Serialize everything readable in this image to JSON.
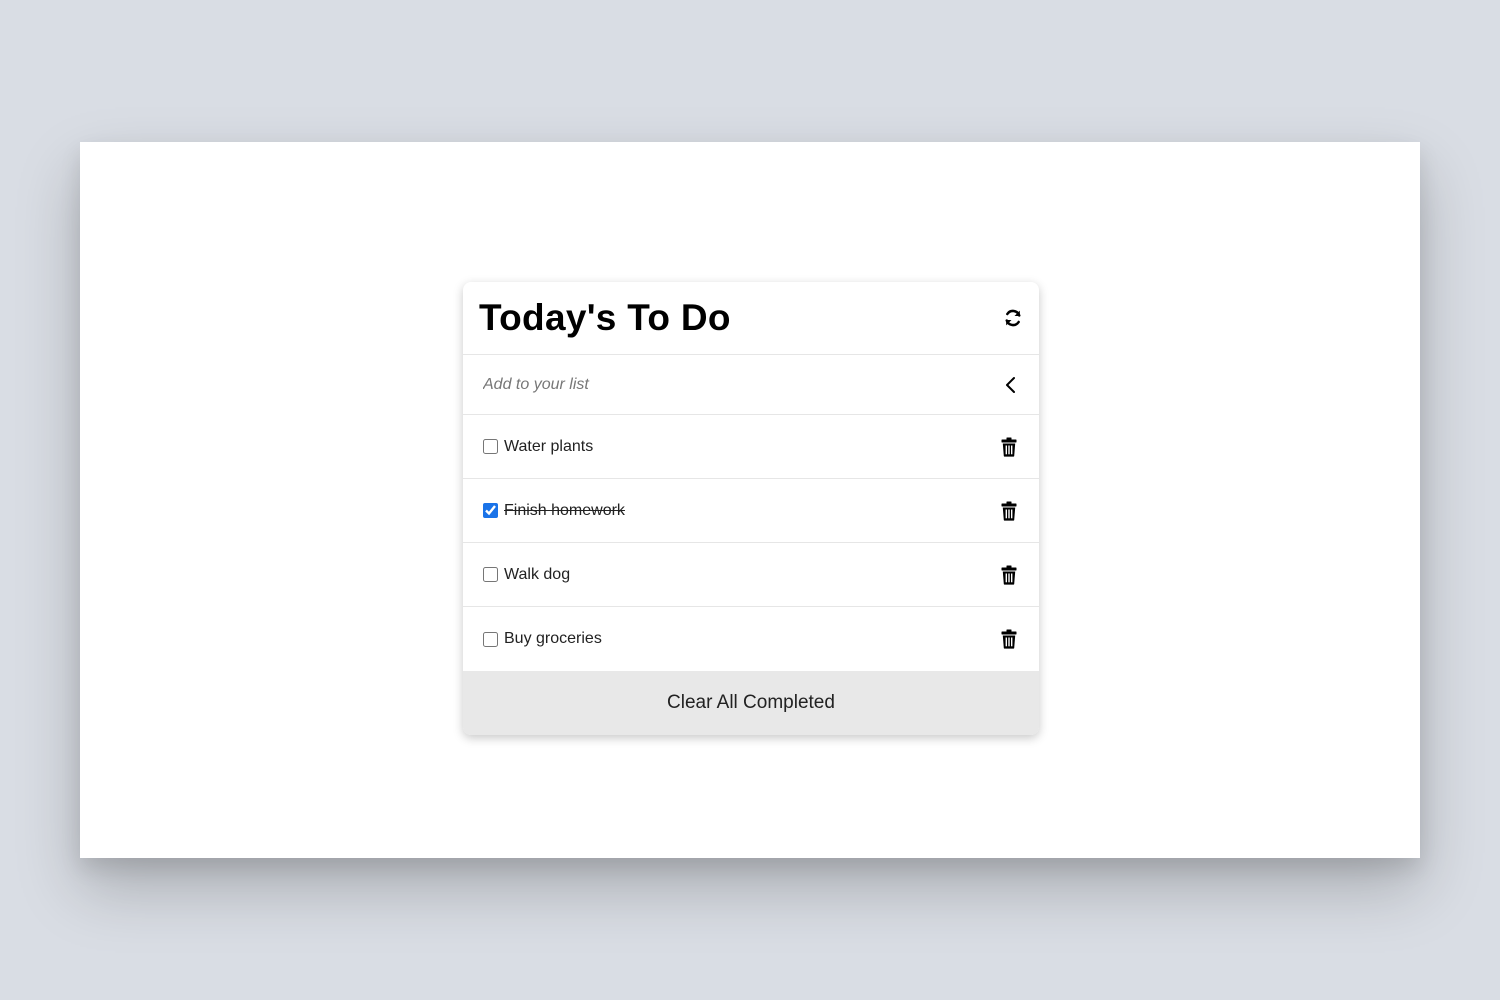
{
  "app": {
    "title": "Today's To Do"
  },
  "add": {
    "placeholder": "Add to your list"
  },
  "todos": [
    {
      "label": "Water plants",
      "completed": false
    },
    {
      "label": "Finish homework",
      "completed": true
    },
    {
      "label": "Walk dog",
      "completed": false
    },
    {
      "label": "Buy groceries",
      "completed": false
    }
  ],
  "footer": {
    "clear_label": "Clear All Completed"
  },
  "icons": {
    "refresh": "refresh-icon",
    "collapse": "chevron-left-icon",
    "delete": "trash-icon"
  },
  "colors": {
    "checkbox_accent": "#1a73e8",
    "footer_bg": "#e8e8e8"
  }
}
